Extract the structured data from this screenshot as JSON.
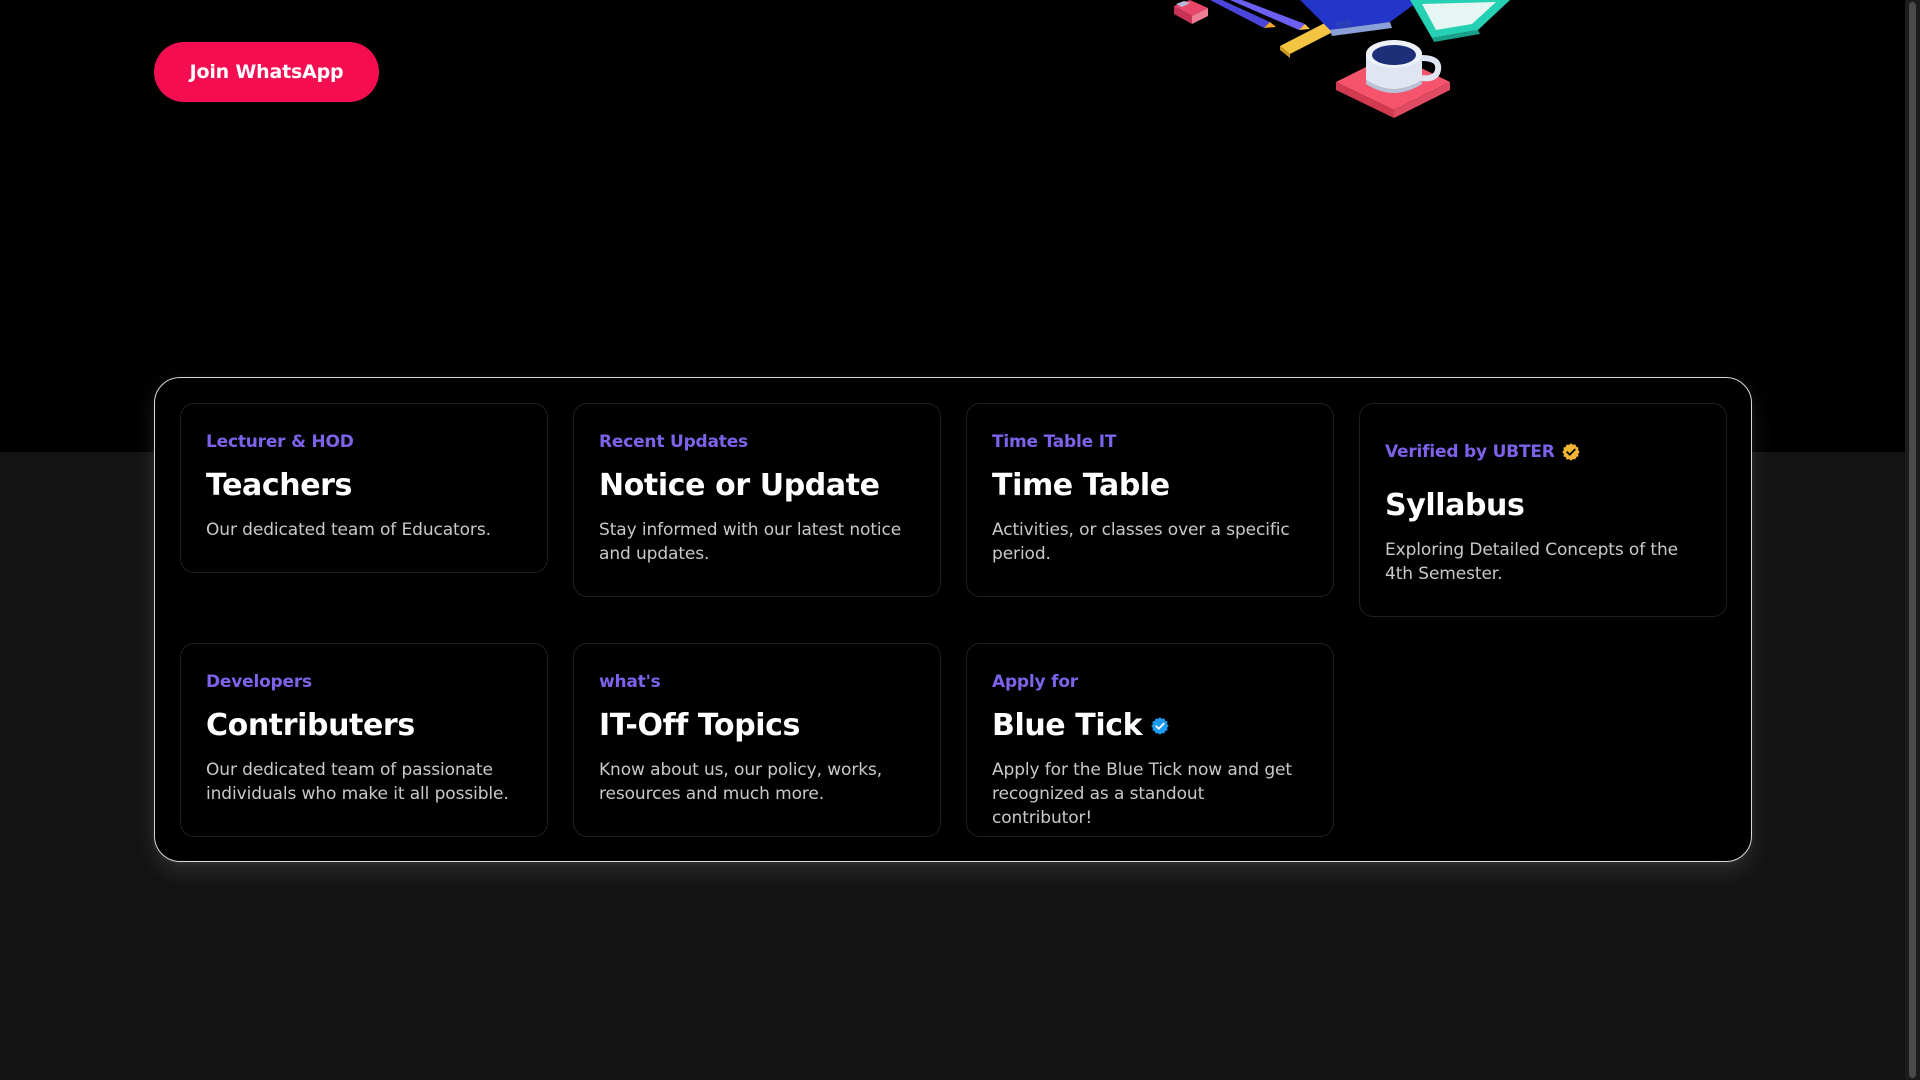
{
  "hero": {
    "join_button_label": "Join WhatsApp",
    "illustration": "isometric-desk-illustration"
  },
  "cards": [
    {
      "eyebrow": "Lecturer & HOD",
      "title": "Teachers",
      "description": "Our dedicated team of Educators."
    },
    {
      "eyebrow": "Recent Updates",
      "title": "Notice or Update",
      "description": "Stay informed with our latest notice and updates."
    },
    {
      "eyebrow": "Time Table IT",
      "title": "Time Table",
      "description": "Activities, or classes over a specific period."
    },
    {
      "eyebrow": "Verified by UBTER",
      "eyebrow_icon": "gold-verified-badge-icon",
      "title": "Syllabus",
      "description": "Exploring Detailed Concepts of the 4th Semester."
    },
    {
      "eyebrow": "Developers",
      "title": "Contributers",
      "description": "Our dedicated team of passionate individuals who make it all possible."
    },
    {
      "eyebrow": "what's",
      "title": "IT-Off Topics",
      "description": "Know about us, our policy, works, resources and much more."
    },
    {
      "eyebrow": "Apply for",
      "title": "Blue Tick",
      "title_icon": "blue-verified-badge-icon",
      "description": "Apply for the Blue Tick now and get recognized as a standout contributor!"
    }
  ],
  "colors": {
    "accent": "#f50d52",
    "eyebrow": "#7d62ea",
    "hero_background": "#000000",
    "page_background": "#131313",
    "gold_badge": "#f2b632",
    "blue_badge": "#1d9bf0"
  }
}
